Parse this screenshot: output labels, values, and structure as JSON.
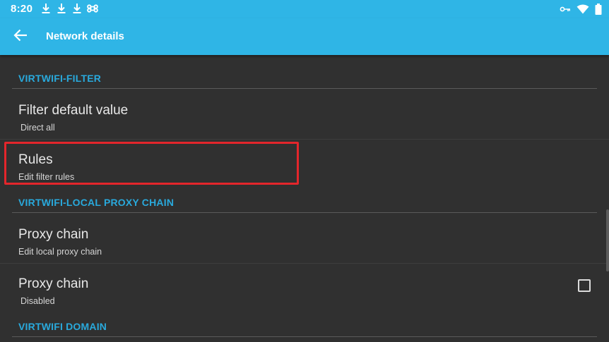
{
  "status_bar": {
    "time": "8:20",
    "left_icons": [
      "download-icon",
      "download-icon",
      "download-icon",
      "command-icon"
    ],
    "right_icons": [
      "vpn-key-icon",
      "wifi-icon",
      "battery-icon"
    ]
  },
  "app_bar": {
    "title": "Network details",
    "back_icon": "back-arrow-icon"
  },
  "sections": {
    "filter_header": "VIRTWIFI-FILTER",
    "proxy_header": "VIRTWIFI-LOCAL PROXY CHAIN",
    "domain_header": "VIRTWIFI DOMAIN"
  },
  "items": {
    "filter_default": {
      "title": "Filter default value",
      "summary": "Direct all"
    },
    "rules": {
      "title": "Rules",
      "summary": "Edit filter rules"
    },
    "proxy_chain_edit": {
      "title": "Proxy chain",
      "summary": "Edit local proxy chain"
    },
    "proxy_chain_toggle": {
      "title": "Proxy chain",
      "summary": "Disabled",
      "checked": false
    }
  },
  "colors": {
    "accent": "#2fb5e6",
    "section_header": "#29a9dc",
    "background": "#303030",
    "highlight": "#e3262b"
  }
}
